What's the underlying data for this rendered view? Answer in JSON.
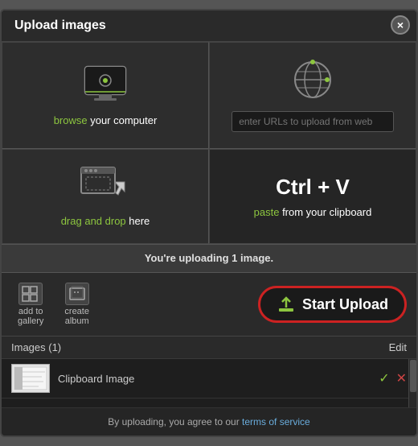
{
  "modal": {
    "title": "Upload images",
    "close_label": "×"
  },
  "browse_option": {
    "label_green": "browse",
    "label_white": " your computer"
  },
  "web_option": {
    "placeholder": "enter URLs to upload from web"
  },
  "drag_option": {
    "label_green": "drag and drop",
    "label_white": " here"
  },
  "paste_option": {
    "ctrl_label": "Ctrl + V",
    "paste_green": "paste",
    "paste_white": " from your clipboard"
  },
  "status_bar": {
    "text": "You're uploading 1 image."
  },
  "action_bar": {
    "gallery_label": "add to\ngallery",
    "album_label": "create\nalbum",
    "start_upload_label": "Start Upload"
  },
  "images_section": {
    "header_label": "Images (1)",
    "edit_label": "Edit"
  },
  "image_item": {
    "name": "Clipboard Image"
  },
  "footer": {
    "text": "By uploading, you agree to our ",
    "link_text": "terms of service"
  }
}
